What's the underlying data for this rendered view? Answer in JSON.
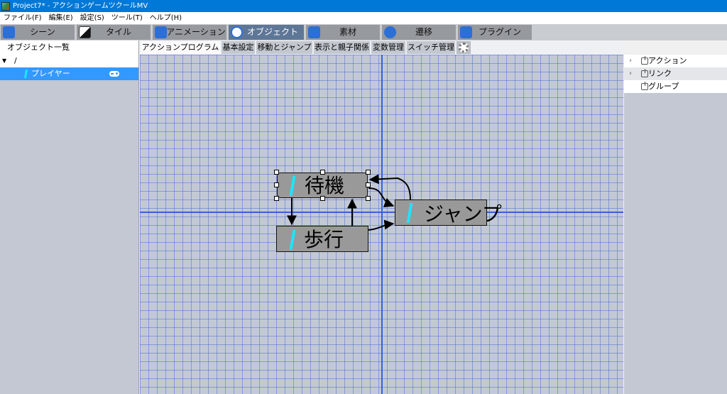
{
  "window": {
    "title": "Project7* - アクションゲームツクールMV"
  },
  "menubar": {
    "items": [
      "ファイル(F)",
      "編集(E)",
      "設定(S)",
      "ツール(T)",
      "ヘルプ(H)"
    ]
  },
  "main_tabs": [
    {
      "label": "シーン",
      "icon": "scene-icon",
      "active": false
    },
    {
      "label": "タイル",
      "icon": "tile-icon",
      "active": false
    },
    {
      "label": "アニメーション",
      "icon": "animation-icon",
      "active": false
    },
    {
      "label": "オブジェクト",
      "icon": "object-icon",
      "active": true
    },
    {
      "label": "素材",
      "icon": "asset-icon",
      "active": false
    },
    {
      "label": "遷移",
      "icon": "transition-icon",
      "active": false
    },
    {
      "label": "プラグイン",
      "icon": "plugin-icon",
      "active": false
    }
  ],
  "object_list": {
    "header": "オブジェクト一覧",
    "root": {
      "toggle": "▼",
      "label": "/"
    },
    "items": [
      {
        "label": "プレイヤー",
        "icon": "gamepad-icon",
        "selected": true
      }
    ]
  },
  "sub_tabs": [
    {
      "label": "アクションプログラム",
      "active": true
    },
    {
      "label": "基本設定",
      "active": false
    },
    {
      "label": "移動とジャンプ",
      "active": false
    },
    {
      "label": "表示と親子関係",
      "active": false
    },
    {
      "label": "変数管理",
      "active": false
    },
    {
      "label": "スイッチ管理",
      "active": false
    }
  ],
  "action_program": {
    "actions": [
      {
        "id": "idle",
        "label": "待機",
        "selected": true
      },
      {
        "id": "walk",
        "label": "歩行",
        "selected": false
      },
      {
        "id": "jump",
        "label": "ジャンプ",
        "selected": false
      }
    ],
    "links": [
      {
        "from": "idle",
        "to": "walk"
      },
      {
        "from": "walk",
        "to": "idle"
      },
      {
        "from": "idle",
        "to": "jump"
      },
      {
        "from": "jump",
        "to": "idle"
      },
      {
        "from": "walk",
        "to": "jump"
      }
    ]
  },
  "palette": {
    "items": [
      {
        "label": "アクション",
        "expandable": true
      },
      {
        "label": "リンク",
        "expandable": true
      },
      {
        "label": "グループ",
        "expandable": false
      }
    ]
  },
  "colors": {
    "accent": "#0078d7",
    "active_tab": "#5f7797",
    "selection": "#3399ff",
    "grid_line": "#3a60d8",
    "action_fill": "#999999",
    "flash_icon": "#19e6ff"
  }
}
